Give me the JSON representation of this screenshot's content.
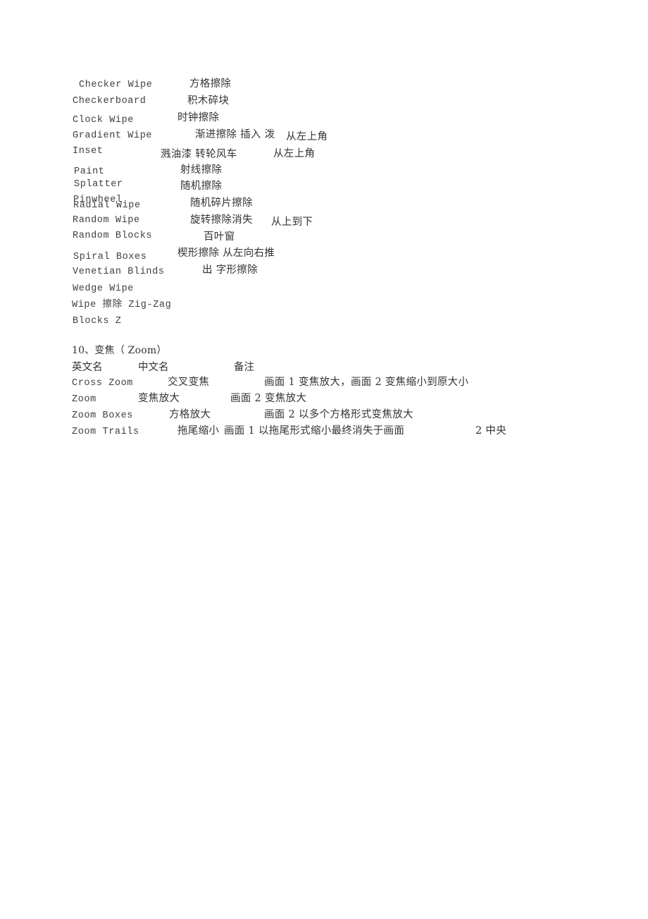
{
  "document": {
    "page_background": "#ffffff",
    "text_color": "#3a3a3a"
  },
  "wipe_section": {
    "english_names": [
      "Checker Wipe",
      "Checkerboard",
      "Clock Wipe",
      "Gradient Wipe",
      "Inset",
      "Paint",
      "Splatter",
      "Pinwheel",
      "Radial Wipe",
      "Random Wipe",
      "Random Blocks",
      "Spiral Boxes",
      "Venetian Blinds",
      "Wedge Wipe",
      "Wipe 擦除 Zig-Zag",
      "Blocks Z"
    ],
    "chinese_glosses": [
      "方格擦除",
      "积木碎块",
      "时钟擦除",
      "渐进擦除 插入 泼",
      "溅油漆 转轮风车",
      "射线擦除",
      "随机擦除",
      "随机碎片擦除",
      "旋转擦除消失",
      "百叶窗",
      "楔形擦除 从左向右推",
      "出 字形擦除"
    ],
    "notes": [
      "从左上角",
      "从左上角",
      "从上到下"
    ]
  },
  "zoom_section": {
    "heading": "10、变焦（ Zoom）",
    "columns": {
      "english": "英文名",
      "chinese": "中文名",
      "remark": "备注"
    },
    "rows": [
      {
        "english": "Cross Zoom",
        "chinese": "交叉变焦",
        "remark": "画面 1 变焦放大，画面 2 变焦缩小到原大小",
        "remark_tail": ""
      },
      {
        "english": "Zoom",
        "chinese": "变焦放大",
        "remark": "画面 2 变焦放大",
        "remark_tail": ""
      },
      {
        "english": "Zoom Boxes",
        "chinese": "方格放大",
        "remark": "画面 2 以多个方格形式变焦放大",
        "remark_tail": ""
      },
      {
        "english": "Zoom Trails",
        "chinese": "拖尾缩小",
        "remark": "画面 1 以拖尾形式缩小最终消失于画面",
        "remark_tail": "2 中央"
      }
    ]
  }
}
